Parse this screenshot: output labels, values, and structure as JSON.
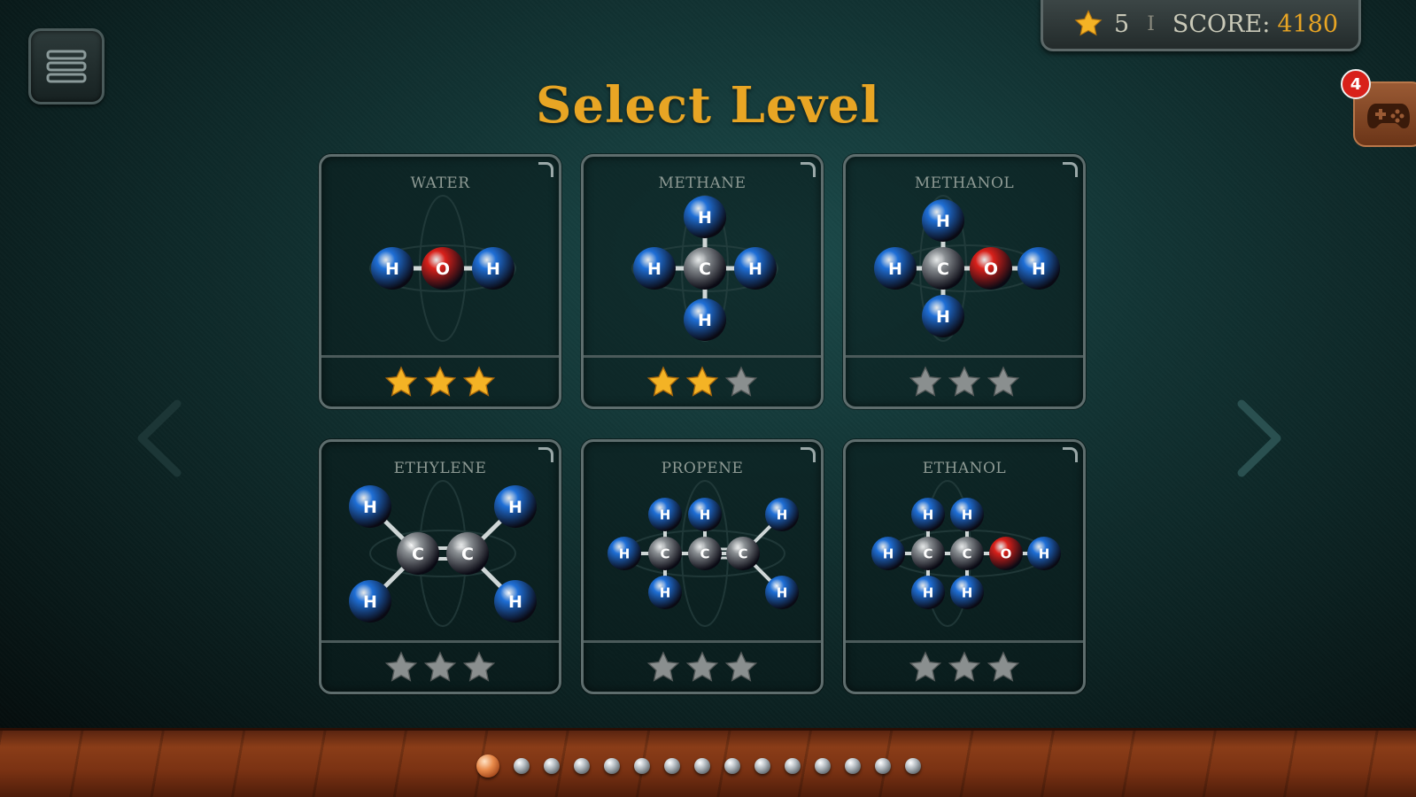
{
  "header": {
    "title": "Select Level",
    "stars_total": "5",
    "separator": "I",
    "score_label": "SCORE:",
    "score_value": "4180",
    "notification_count": "4"
  },
  "levels": [
    {
      "name": "WATER",
      "stars_earned": 3,
      "stars_max": 3
    },
    {
      "name": "METHANE",
      "stars_earned": 2,
      "stars_max": 3
    },
    {
      "name": "METHANOL",
      "stars_earned": 0,
      "stars_max": 3
    },
    {
      "name": "ETHYLENE",
      "stars_earned": 0,
      "stars_max": 3
    },
    {
      "name": "PROPENE",
      "stars_earned": 0,
      "stars_max": 3
    },
    {
      "name": "ETHANOL",
      "stars_earned": 0,
      "stars_max": 3
    }
  ],
  "atom_labels": {
    "hydrogen": "H",
    "carbon": "C",
    "oxygen": "O"
  },
  "colors": {
    "accent": "#e8a524",
    "hydrogen": "#1f6fd6",
    "carbon": "#8a8f93",
    "oxygen": "#d8201a",
    "star_gold": "#f4b325",
    "star_empty": "#8a8f8f"
  },
  "pagination": {
    "total_pages": 15,
    "current_page": 1
  },
  "icons": {
    "menu": "menu-list-icon",
    "star": "star-icon",
    "games": "gamepad-icon",
    "prev": "chevron-left-icon",
    "next": "chevron-right-icon"
  }
}
